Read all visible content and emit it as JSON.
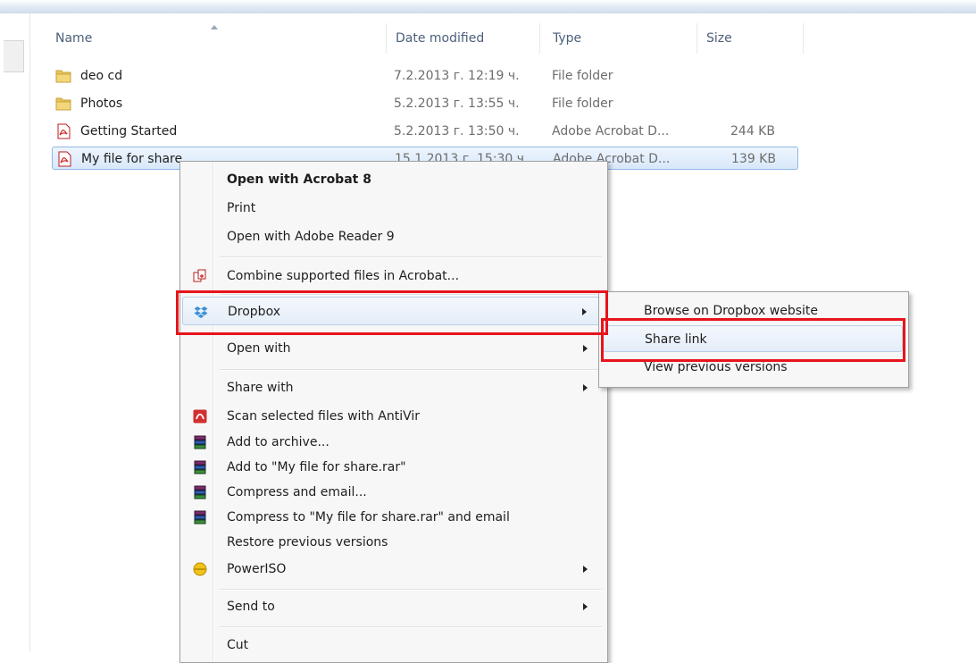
{
  "columns": {
    "name": "Name",
    "date": "Date modified",
    "type": "Type",
    "size": "Size"
  },
  "files": [
    {
      "name": "deo cd",
      "date": "7.2.2013 г. 12:19 ч.",
      "type": "File folder",
      "size": "",
      "icon": "folder-icon"
    },
    {
      "name": "Photos",
      "date": "5.2.2013 г. 13:55 ч.",
      "type": "File folder",
      "size": "",
      "icon": "folder-icon"
    },
    {
      "name": "Getting Started",
      "date": "5.2.2013 г. 13:50 ч.",
      "type": "Adobe Acrobat D...",
      "size": "244 KB",
      "icon": "pdf-icon"
    },
    {
      "name": "My file for share",
      "date": "15.1.2013 г. 15:30 ч.",
      "type": "Adobe Acrobat D...",
      "size": "139 KB",
      "icon": "pdf-icon",
      "selected": true
    }
  ],
  "context_menu": {
    "items": [
      {
        "label": "Open with Acrobat 8",
        "bold": true
      },
      {
        "label": "Print"
      },
      {
        "label": "Open with Adobe Reader 9"
      },
      {
        "label": "Combine supported files in Acrobat...",
        "icon": "acrobat-combine-icon"
      },
      {
        "label": "Dropbox",
        "icon": "dropbox-icon",
        "submenu": true,
        "highlighted": true
      },
      {
        "label": "Open with",
        "submenu": true
      },
      {
        "label": "Share with",
        "submenu": true
      },
      {
        "label": "Scan selected files with AntiVir",
        "icon": "antivir-icon"
      },
      {
        "label": "Add to archive...",
        "icon": "winrar-icon"
      },
      {
        "label": "Add to \"My file for share.rar\"",
        "icon": "winrar-icon"
      },
      {
        "label": "Compress and email...",
        "icon": "winrar-icon"
      },
      {
        "label": "Compress to \"My file for share.rar\" and email",
        "icon": "winrar-icon"
      },
      {
        "label": "Restore previous versions"
      },
      {
        "label": "PowerISO",
        "icon": "poweriso-icon",
        "submenu": true
      },
      {
        "label": "Send to",
        "submenu": true
      },
      {
        "label": "Cut"
      }
    ]
  },
  "dropbox_submenu": {
    "items": [
      {
        "label": "Browse on Dropbox website"
      },
      {
        "label": "Share link",
        "highlighted": true
      },
      {
        "label": "View previous versions"
      }
    ]
  },
  "colors": {
    "annotation": "#e8141b",
    "selection": "#d8e8fa",
    "header_text": "#4c607a"
  }
}
